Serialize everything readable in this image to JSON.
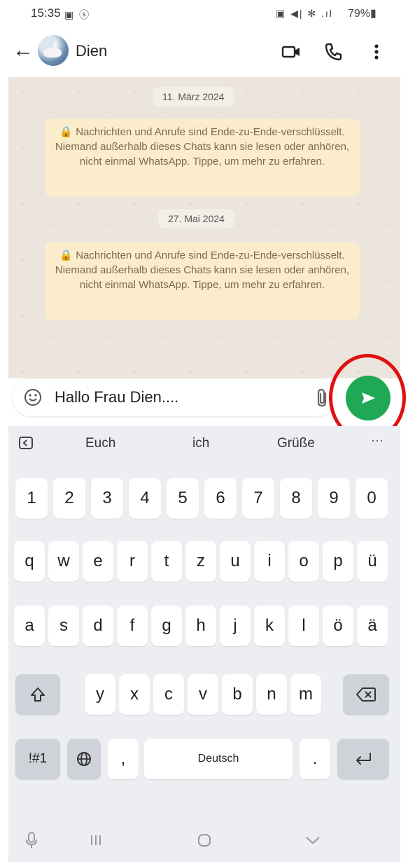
{
  "status_bar": {
    "time": "15:35",
    "left_icons": "▣ ⓢ",
    "right_icons": "▣ ◀| ✻ .ıl",
    "battery": "79%▮"
  },
  "header": {
    "contact_name": "Dien",
    "video_icon": "video-camera-icon",
    "call_icon": "phone-icon",
    "menu_icon": "more-vert-icon"
  },
  "chat": {
    "date1": "11. März 2024",
    "system_message1": "🔒 Nachrichten und Anrufe sind Ende-zu-Ende-verschlüsselt. Niemand außerhalb dieses Chats kann sie lesen oder anhören, nicht einmal WhatsApp. Tippe, um mehr zu erfahren.",
    "date2": "27. Mai 2024",
    "system_message2": "🔒 Nachrichten und Anrufe sind Ende-zu-Ende-verschlüsselt. Niemand außerhalb dieses Chats kann sie lesen oder anhören, nicht einmal WhatsApp. Tippe, um mehr zu erfahren."
  },
  "composer": {
    "text": "Hallo Frau Dien....",
    "emoji_icon": "emoji-icon",
    "attach_icon": "paperclip-icon",
    "send_icon": "send-icon",
    "accent_color": "#1fa855",
    "highlight_color": "#e01010"
  },
  "keyboard": {
    "suggestions": [
      "Euch",
      "ich",
      "Grüße"
    ],
    "more": "···",
    "row_numbers": [
      "1",
      "2",
      "3",
      "4",
      "5",
      "6",
      "7",
      "8",
      "9",
      "0"
    ],
    "row_top": [
      "q",
      "w",
      "e",
      "r",
      "t",
      "z",
      "u",
      "i",
      "o",
      "p",
      "ü"
    ],
    "row_mid": [
      "a",
      "s",
      "d",
      "f",
      "g",
      "h",
      "j",
      "k",
      "l",
      "ö",
      "ä"
    ],
    "row_bottom": [
      "y",
      "x",
      "c",
      "v",
      "b",
      "n",
      "m"
    ],
    "symbols_label": "!#1",
    "comma": ",",
    "space_label": "Deutsch",
    "period": "."
  },
  "nav": {
    "mic_icon": "microphone-icon",
    "recents_icon": "recent-apps-icon",
    "home_icon": "home-icon",
    "back_icon": "hide-keyboard-icon"
  }
}
